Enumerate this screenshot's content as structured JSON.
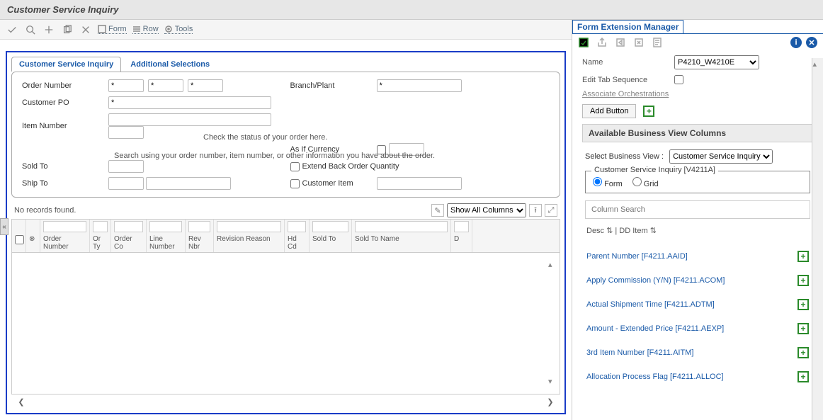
{
  "titlebar": "Customer Service Inquiry",
  "toolbar": {
    "form": "Form",
    "row": "Row",
    "tools": "Tools"
  },
  "tabs": {
    "active": "Customer Service Inquiry",
    "other": "Additional Selections"
  },
  "form": {
    "order_number_lbl": "Order Number",
    "branch_plant_lbl": "Branch/Plant",
    "customer_po_lbl": "Customer PO",
    "item_number_lbl": "Item Number",
    "as_if_currency_lbl": "As If Currency",
    "extend_back_lbl": "Extend Back Order Quantity",
    "sold_to_lbl": "Sold To",
    "customer_item_lbl": "Customer Item",
    "ship_to_lbl": "Ship To",
    "star": "*",
    "hint1": "Check the status of your order here.",
    "hint2": "Search using your order number, item number, or other information you have about the order."
  },
  "grid": {
    "status": "No records found.",
    "show_all": "Show All Columns",
    "headers": {
      "order_number": "Order Number",
      "or_ty": "Or Ty",
      "order_co": "Order Co",
      "line_number": "Line Number",
      "rev_nbr": "Rev Nbr",
      "revision_reason": "Revision Reason",
      "hd_cd": "Hd Cd",
      "sold_to": "Sold To",
      "sold_to_name": "Sold To Name",
      "d": "D"
    }
  },
  "fem": {
    "title": "Form Extension Manager",
    "name_lbl": "Name",
    "name_value": "P4210_W4210E",
    "edit_tab_lbl": "Edit Tab Sequence",
    "assoc_orch": "Associate Orchestrations",
    "add_button": "Add Button",
    "avail_cols": "Available Business View Columns",
    "select_view_lbl": "Select Business View :",
    "select_view_value": "Customer Service Inquiry",
    "radio_legend": "Customer Service Inquiry [V4211A]",
    "radio_form": "Form",
    "radio_grid": "Grid",
    "col_search_ph": "Column Search",
    "sort_head": "Desc ⇅  | DD Item ⇅",
    "columns": [
      "Parent Number [F4211.AAID]",
      "Apply Commission (Y/N) [F4211.ACOM]",
      "Actual Shipment Time [F4211.ADTM]",
      "Amount - Extended Price [F4211.AEXP]",
      "3rd Item Number [F4211.AITM]",
      "Allocation Process Flag [F4211.ALLOC]"
    ]
  }
}
